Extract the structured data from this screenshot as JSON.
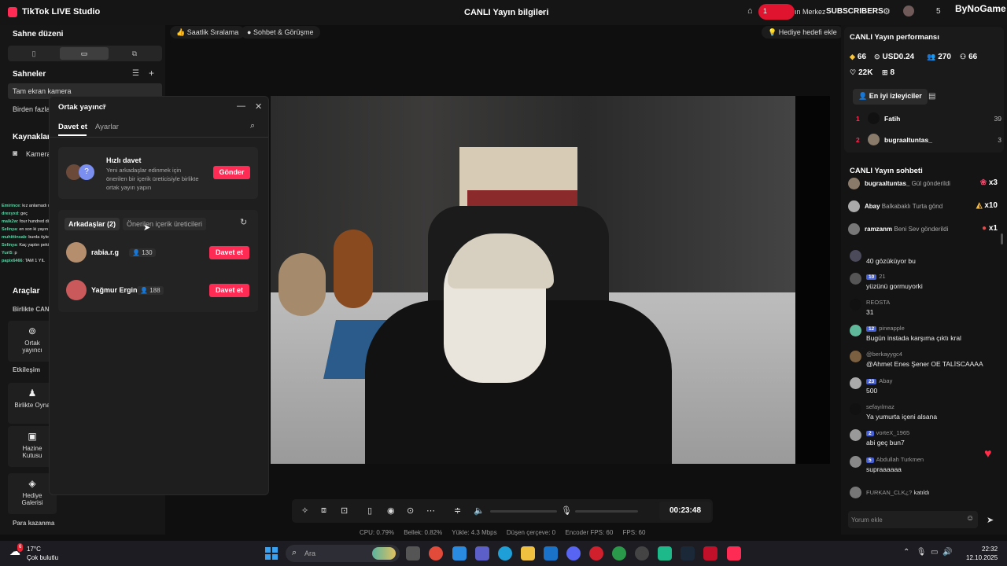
{
  "app": {
    "title": "TikTok LIVE Studio",
    "live_info": "CANLI Yayın bilgileri"
  },
  "overlay": {
    "pill": "1",
    "merkez": "ın Merkez",
    "subscribers": "SUBSCRIBERS",
    "count": "5",
    "brand": "ByNoGame"
  },
  "left": {
    "scene_layout_title": "Sahne düzeni",
    "scenes_title": "Sahneler",
    "scenes": [
      "Tam ekran kamera",
      "Birden fazla"
    ],
    "sources_title": "Kaynaklar",
    "source_camera": "Kamera",
    "tools_title": "Araçlar",
    "together_cut": "Birlikte CAN",
    "tools": [
      {
        "label": "Ortak\nyayıncı"
      },
      {
        "label": "Birlikte Oyna"
      },
      {
        "label": "Hazine\nKutusu"
      },
      {
        "label": "Hediye\nGalerisi"
      }
    ],
    "interaction_title": "Etkileşim",
    "earn_title": "Para kazanma"
  },
  "left_chat": [
    {
      "user": "Emirince",
      "msg": ": kız anlamadı ne diyor bu"
    },
    {
      "user": "drexyxd",
      "msg": ": geç"
    },
    {
      "user": "malk2w",
      "msg": ": four hundred diyor"
    },
    {
      "user": "Selinya",
      "msg": ": en son ki yayın buradaydım sen yoktun"
    },
    {
      "user": "muhittinsab",
      "msg": ": burda öyle sınav yok, bura senaryo"
    },
    {
      "user": "Selinya",
      "msg": ": Kaç yaptın peki"
    },
    {
      "user": "Yuri5",
      "msg": ": p"
    },
    {
      "user": "papix6466",
      "msg": ": TAM 1 YIL"
    }
  ],
  "top_pills": {
    "hourly": "Saatlik Sıralama",
    "chat_meet": "Sohbet & Görüşme",
    "gift_goal": "Hediye hedefi ekle"
  },
  "invite": {
    "title": "Ortak yayıncı",
    "tabs": [
      "Davet et",
      "Ayarlar"
    ],
    "quick_title": "Hızlı davet",
    "quick_desc": "Yeni arkadaşlar edinmek için önerilen bir içerik üreticisiyle birlikte ortak yayın yapın",
    "send": "Gönder",
    "friends_tab": "Arkadaşlar (2)",
    "suggested_tab": "Önerilen içerik üreticileri",
    "friends": [
      {
        "name": "rabia.r.g",
        "count": "130",
        "btn": "Davet et"
      },
      {
        "name": "Yağmur Ergin",
        "count": "188",
        "btn": "Davet et"
      }
    ]
  },
  "controls": {
    "timer": "00:23:48"
  },
  "stats": {
    "cpu": "CPU: 0.79%",
    "mem": "Bellek: 0.82%",
    "upload": "Yükle: 4.3 Mbps",
    "dropped": "Düşen çerçeve: 0",
    "encoder": "Encoder FPS: 60",
    "fps": "FPS: 60"
  },
  "performance": {
    "title": "CANLI Yayın performansı",
    "diamonds": "66",
    "usd": "USD0.24",
    "viewers": "270",
    "followers": "66",
    "likes": "22K",
    "gifts": "8",
    "top_viewers_tab": "En iyi izleyiciler",
    "top": [
      {
        "rank": "1",
        "name": "Fatih",
        "value": "39"
      },
      {
        "rank": "2",
        "name": "bugraaltuntas_",
        "value": "3"
      }
    ]
  },
  "chat": {
    "title": "CANLI Yayın sohbeti",
    "gifts": [
      {
        "user": "bugraaltuntas_",
        "text": "Gül gönderildi",
        "x": "x3"
      },
      {
        "user": "Abay",
        "text": "Balkabaklı Turta gönd",
        "x": "x10"
      },
      {
        "user": "ramzanm",
        "text": "Beni Sev gönderildi",
        "x": "x1"
      }
    ],
    "messages": [
      {
        "badge": "",
        "user": "",
        "msg": "40 gözüküyor bu"
      },
      {
        "badge": "10",
        "user": "21",
        "msg": "yüzünü gormuyorki"
      },
      {
        "badge": "",
        "user": "REOSTA",
        "msg": "31"
      },
      {
        "badge": "12",
        "user": "pineapple",
        "msg": "Bugün instada karşıma çıktı kral"
      },
      {
        "badge": "",
        "user": "@berkayygc4",
        "msg": "@Ahmet Enes Şener OE TALİSCAAAA"
      },
      {
        "badge": "23",
        "user": "Abay",
        "msg": "500"
      },
      {
        "badge": "",
        "user": "sefayılmaz",
        "msg": "Ya yumurta içeni alsana"
      },
      {
        "badge": "2",
        "user": "vorteX_1965",
        "msg": "abi geç bun7"
      },
      {
        "badge": "5",
        "user": "Abdullah Turkmen",
        "msg": "supraaaaaa"
      }
    ],
    "joined_user": "FURKAN_CLK¿?",
    "joined_text": "katıldı",
    "placeholder": "Yorum ekle"
  },
  "taskbar": {
    "temp": "17°C",
    "weather": "Çok bulutlu",
    "weather_badge": "6",
    "search": "Ara",
    "time": "22:32",
    "date": "12.10.2025"
  },
  "colors": {
    "accent": "#fe2c55",
    "bg": "#0f0f10",
    "panel": "#1e1e1f"
  }
}
